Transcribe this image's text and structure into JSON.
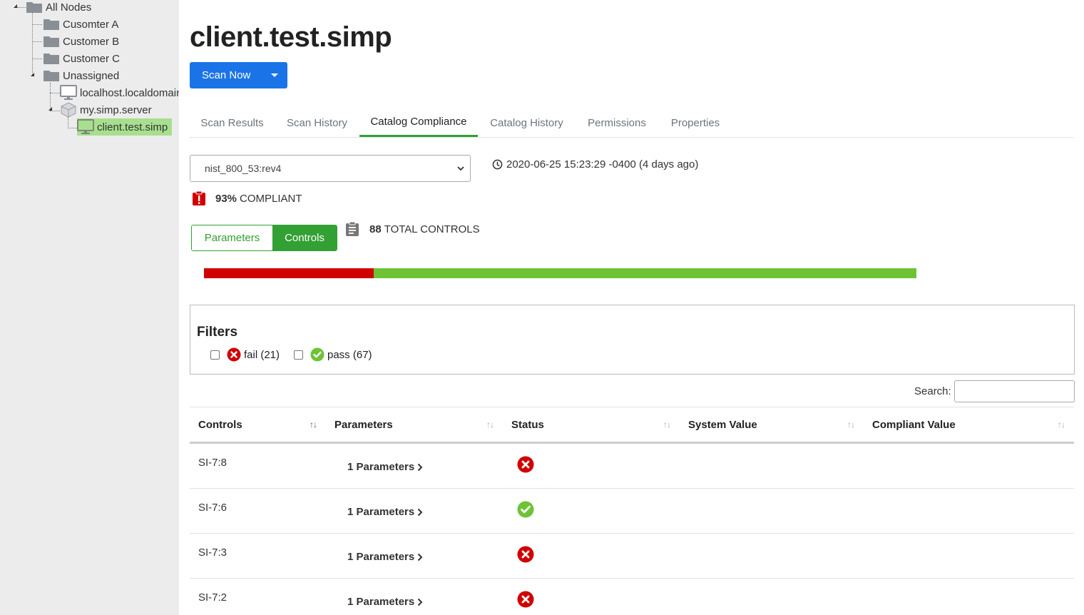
{
  "sidebar": {
    "tree": {
      "root": "All Nodes",
      "customers": [
        "Cusomter A",
        "Customer B",
        "Customer C"
      ],
      "unassigned": "Unassigned",
      "localhost": "localhost.localdomain",
      "server": "my.simp.server",
      "client": "client.test.simp"
    }
  },
  "page": {
    "title": "client.test.simp",
    "scan_button": "Scan Now"
  },
  "tabs": [
    "Scan Results",
    "Scan History",
    "Catalog Compliance",
    "Catalog History",
    "Permissions",
    "Properties"
  ],
  "active_tab": "Catalog Compliance",
  "catalog": {
    "selected": "nist_800_53:rev4",
    "timestamp": "2020-06-25 15:23:29 -0400 (4 days ago)",
    "compliance_percent": "93%",
    "compliance_label": "COMPLIANT",
    "total_controls_count": "88",
    "total_controls_label": "TOTAL CONTROLS",
    "fail_count": 21,
    "pass_count": 67
  },
  "toggle": {
    "parameters": "Parameters",
    "controls": "Controls"
  },
  "filters": {
    "title": "Filters",
    "fail": "fail (21)",
    "pass": "pass (67)"
  },
  "search": {
    "label": "Search:",
    "value": ""
  },
  "table": {
    "headers": [
      "Controls",
      "Parameters",
      "Status",
      "System Value",
      "Compliant Value"
    ],
    "rows": [
      {
        "control": "SI-7:8",
        "params": "1 Parameters",
        "status": "fail"
      },
      {
        "control": "SI-7:6",
        "params": "1 Parameters",
        "status": "pass"
      },
      {
        "control": "SI-7:3",
        "params": "1 Parameters",
        "status": "fail"
      },
      {
        "control": "SI-7:2",
        "params": "1 Parameters",
        "status": "fail"
      }
    ]
  },
  "colors": {
    "primary": "#1a74e8",
    "success": "#33a033",
    "fail": "#d10000",
    "pass": "#6ec335",
    "selected_node": "#a8df8f"
  }
}
